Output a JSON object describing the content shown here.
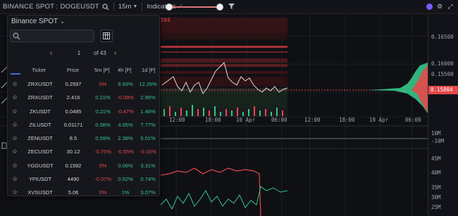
{
  "toolbar": {
    "symbol": "BINANCE SPOT : DOGEUSDT",
    "interval": "15m",
    "indicators_label": "Indicators"
  },
  "price_axis": {
    "labels": [
      "0.16500",
      "0.16000",
      "0.15500"
    ],
    "current_price": "0.15804"
  },
  "volume_axis": {
    "labels": [
      "10M",
      "-10M"
    ]
  },
  "lower_axis": {
    "labels": [
      "45M",
      "40M",
      "35M",
      "30M",
      "25M"
    ]
  },
  "time_axis": {
    "labels": [
      "12:00",
      "18:00",
      "10 Apr",
      "06:00",
      "12:00",
      "18:00",
      "19 Apr",
      "06:00"
    ]
  },
  "colors": {
    "up": "#36c58a",
    "down": "#e5484d",
    "accent": "#3b6fd1",
    "price_tag": "#e54848"
  },
  "watchlist": {
    "exchange": "Binance SPOT",
    "search_placeholder": "",
    "page": "1",
    "of_pages": "of 43",
    "columns": [
      "Ticker",
      "Price",
      "5m [P]",
      "4h [P]",
      "1d [P]"
    ],
    "rows": [
      {
        "ticker": "ZRXUSDT",
        "price": "0.2597",
        "c5": "0%",
        "c5_dir": "neg",
        "c4": "8.93%",
        "c4_dir": "pos",
        "c1": "12.26%",
        "c1_dir": "pos"
      },
      {
        "ticker": "ZRXUSDT",
        "price": "2.416",
        "c5": "0.21%",
        "c5_dir": "pos",
        "c4": "-0.08%",
        "c4_dir": "neg",
        "c1": "2.96%",
        "c1_dir": "pos"
      },
      {
        "ticker": "ZKUSDT",
        "price": "0.0485",
        "c5": "0.21%",
        "c5_dir": "pos",
        "c4": "-0.47%",
        "c4_dir": "neg",
        "c1": "1.46%",
        "c1_dir": "pos"
      },
      {
        "ticker": "ZILUSDT",
        "price": "0.01171",
        "c5": "0.08%",
        "c5_dir": "pos",
        "c4": "4.05%",
        "c4_dir": "pos",
        "c1": "7.77%",
        "c1_dir": "pos"
      },
      {
        "ticker": "ZENUSDT",
        "price": "8.5",
        "c5": "0.59%",
        "c5_dir": "pos",
        "c4": "2.38%",
        "c4_dir": "pos",
        "c1": "5.01%",
        "c1_dir": "pos"
      },
      {
        "ticker": "ZECUSDT",
        "price": "30.12",
        "c5": "-0.75%",
        "c5_dir": "neg",
        "c4": "-0.55%",
        "c4_dir": "neg",
        "c1": "-0.16%",
        "c1_dir": "neg"
      },
      {
        "ticker": "YGGUSDT",
        "price": "0.1592",
        "c5": "0%",
        "c5_dir": "neg",
        "c4": "0.06%",
        "c4_dir": "pos",
        "c1": "3.31%",
        "c1_dir": "pos"
      },
      {
        "ticker": "YFIUSDT",
        "price": "4490",
        "c5": "-0.07%",
        "c5_dir": "neg",
        "c4": "0.52%",
        "c4_dir": "pos",
        "c1": "0.74%",
        "c1_dir": "pos"
      },
      {
        "ticker": "XVSUSDT",
        "price": "5.06",
        "c5": "0%",
        "c5_dir": "neg",
        "c4": "1%",
        "c4_dir": "pos",
        "c1": "3.07%",
        "c1_dir": "pos"
      }
    ]
  },
  "icons": {
    "search": "search-icon",
    "filter": "filter-icon",
    "settings": "gear-icon",
    "fullscreen": "fullscreen-icon",
    "indicators": "trend-icon",
    "sheet": "spreadsheet-icon",
    "star": "star-icon"
  }
}
